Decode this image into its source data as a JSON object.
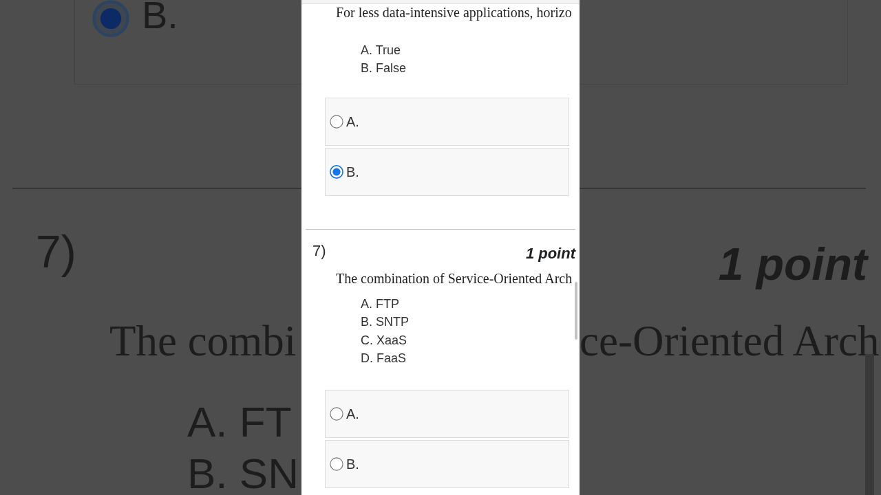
{
  "backdrop": {
    "left": {
      "option": {
        "label": "B.",
        "selected": true
      },
      "number": "7)",
      "question_text": "The combi",
      "choices": [
        "A. FT",
        "B. SN"
      ]
    },
    "right": {
      "points": "1 point",
      "question_text": "ce-Oriented Arch"
    }
  },
  "quiz": {
    "questions": [
      {
        "text": "For less data-intensive applications, horizo",
        "choices": [
          "A. True",
          "B. False"
        ],
        "options": [
          {
            "label": "A.",
            "selected": false
          },
          {
            "label": "B.",
            "selected": true
          }
        ]
      },
      {
        "number": "7)",
        "points": "1 point",
        "text": "The combination of Service-Oriented Arch",
        "choices": [
          "A. FTP",
          "B. SNTP",
          "C. XaaS",
          "D. FaaS"
        ],
        "options": [
          {
            "label": "A.",
            "selected": false
          },
          {
            "label": "B.",
            "selected": false
          }
        ]
      }
    ]
  }
}
